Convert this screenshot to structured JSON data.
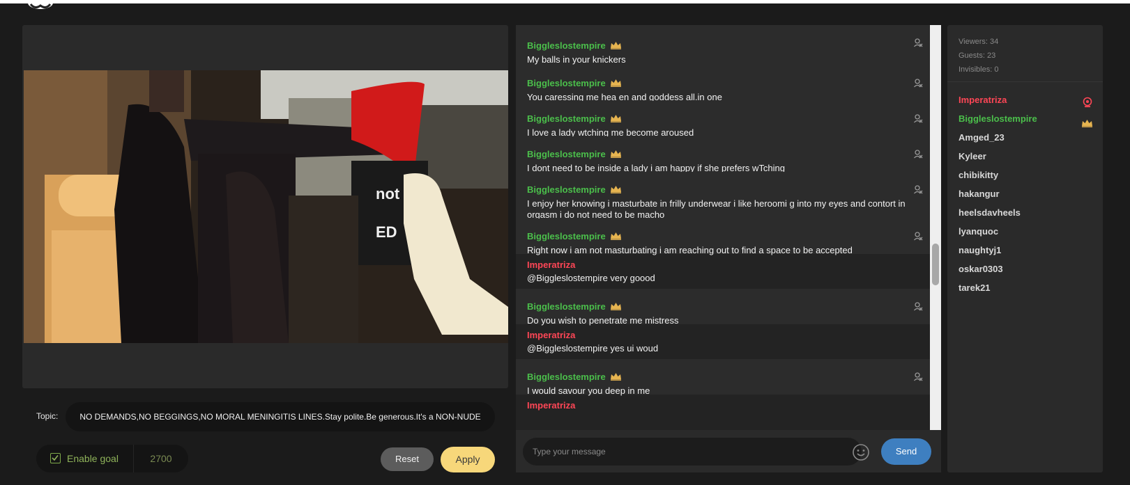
{
  "topic": {
    "label": "Topic:",
    "text": "NO DEMANDS,NO BEGGINGS,NO MORAL MENINGITIS LINES.Stay polite.Be generous.It's a NON-NUDE"
  },
  "goal": {
    "label": "Enable goal",
    "value": "2700",
    "enabled": true
  },
  "buttons": {
    "reset": "Reset",
    "apply": "Apply",
    "send": "Send"
  },
  "chat": {
    "placeholder": "Type your message",
    "messages": [
      {
        "user": "Biggleslostempire",
        "role": "crown",
        "text": "My balls in your knickers"
      },
      {
        "user": "Biggleslostempire",
        "role": "crown",
        "text": "You caressing me hea en and goddess all.in one"
      },
      {
        "user": "Biggleslostempire",
        "role": "crown",
        "text": "I love a lady wtching me become aroused"
      },
      {
        "user": "Biggleslostempire",
        "role": "crown",
        "text": "I dont need to be inside a lady i am happy if she prefers wTching"
      },
      {
        "user": "Biggleslostempire",
        "role": "crown",
        "text": "I enjoy her knowing i masturbate in frilly underwear i like heroomi g into my eyes and contort in orgasm i do not need to be macho"
      },
      {
        "user": "Biggleslostempire",
        "role": "crown",
        "text": "Right now i am not masturbating i am reaching out to find a space to be accepted"
      },
      {
        "user": "Imperatriza",
        "role": "model",
        "text": "@Biggleslostempire very goood"
      },
      {
        "user": "Biggleslostempire",
        "role": "crown",
        "text": "Do you wish to penetrate me mistress"
      },
      {
        "user": "Imperatriza",
        "role": "model",
        "text": "@Biggleslostempire yes ui woud"
      },
      {
        "user": "Biggleslostempire",
        "role": "crown",
        "text": "I would savour you deep in me"
      },
      {
        "user": "Imperatriza",
        "role": "model",
        "text": ""
      }
    ]
  },
  "stats": {
    "viewers": "Viewers: 34",
    "guests": "Guests: 23",
    "invisibles": "Invisibles: 0"
  },
  "users": [
    {
      "name": "Imperatriza",
      "role": "model"
    },
    {
      "name": "Biggleslostempire",
      "role": "crown"
    },
    {
      "name": "Amged_23",
      "role": "user"
    },
    {
      "name": "Kyleer",
      "role": "user"
    },
    {
      "name": "chibikitty",
      "role": "user"
    },
    {
      "name": "hakangur",
      "role": "user"
    },
    {
      "name": "heelsdavheels",
      "role": "user"
    },
    {
      "name": "lyanquoc",
      "role": "user"
    },
    {
      "name": "naughtyj1",
      "role": "user"
    },
    {
      "name": "oskar0303",
      "role": "user"
    },
    {
      "name": "tarek21",
      "role": "user"
    }
  ],
  "colors": {
    "model": "#ff4656",
    "crown_user": "#4bbf4b",
    "apply": "#f7d77a",
    "send": "#3e7fc0",
    "crown_icon": "#e6b450"
  },
  "icons": {
    "crown": "crown-icon",
    "mute": "mute-user-icon",
    "webcam": "webcam-icon",
    "emoji": "smiley-icon",
    "check": "checkbox-checked-icon"
  }
}
